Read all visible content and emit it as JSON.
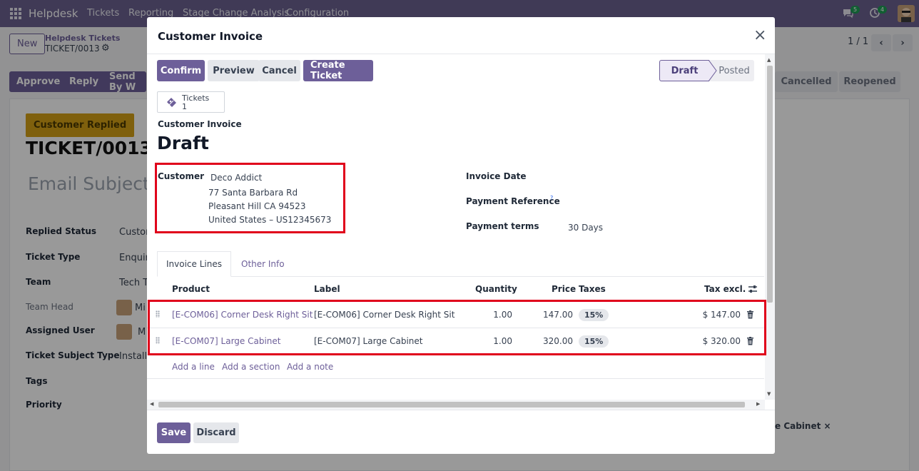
{
  "topbar": {
    "app_name": "Helpdesk",
    "menu": [
      "Tickets",
      "Reporting",
      "Stage Change Analysis",
      "Configuration"
    ],
    "chat_badge": "5",
    "activity_badge": "4"
  },
  "background": {
    "new_button": "New",
    "breadcrumb_parent": "Helpdesk Tickets",
    "breadcrumb_current": "TICKET/0013",
    "pager": "1 / 1",
    "actions": [
      "Approve",
      "Reply",
      "Send By W"
    ],
    "stages": [
      "Cancelled",
      "Reopened"
    ],
    "status_tag": "Customer Replied",
    "ticket_number": "TICKET/0013",
    "subject_placeholder": "Email Subject ...",
    "fields": [
      {
        "label": "Replied Status",
        "value": "Custom"
      },
      {
        "label": "Ticket Type",
        "value": "Enquir"
      },
      {
        "label": "Team",
        "value": "Tech Te"
      },
      {
        "label": "Team Head",
        "value": "Mi"
      },
      {
        "label": "Assigned User",
        "value": "M"
      },
      {
        "label": "Ticket Subject Type",
        "value": "Installa"
      },
      {
        "label": "Tags",
        "value": ""
      },
      {
        "label": "Priority",
        "value": ""
      }
    ],
    "tag_chip": "e Cabinet"
  },
  "modal": {
    "title": "Customer Invoice",
    "buttons": {
      "confirm": "Confirm",
      "preview": "Preview",
      "cancel": "Cancel",
      "create_ticket": "Create Ticket"
    },
    "status_steps": [
      "Draft",
      "Posted"
    ],
    "smart_button": {
      "label": "Tickets",
      "count": "1"
    },
    "doc_type": "Customer Invoice",
    "doc_state": "Draft",
    "customer": {
      "label": "Customer",
      "name": "Deco Addict",
      "street": "77 Santa Barbara Rd",
      "city": "Pleasant Hill CA 94523",
      "country": "United States – US12345673"
    },
    "invoice_date": {
      "label": "Invoice Date",
      "value": ""
    },
    "payment_reference": {
      "label": "Payment Reference",
      "help": "?",
      "value": ""
    },
    "payment_terms": {
      "label": "Payment terms",
      "value": "30 Days"
    },
    "tabs": [
      "Invoice Lines",
      "Other Info"
    ],
    "columns": {
      "product": "Product",
      "label": "Label",
      "quantity": "Quantity",
      "price": "Price",
      "taxes": "Taxes",
      "tax_excl": "Tax excl."
    },
    "lines": [
      {
        "product": "[E-COM06] Corner Desk Right Sit",
        "label": "[E-COM06] Corner Desk Right Sit",
        "quantity": "1.00",
        "price": "147.00",
        "tax": "15%",
        "subtotal": "$ 147.00"
      },
      {
        "product": "[E-COM07] Large Cabinet",
        "label": "[E-COM07] Large Cabinet",
        "quantity": "1.00",
        "price": "320.00",
        "tax": "15%",
        "subtotal": "$ 320.00"
      }
    ],
    "add_links": [
      "Add a line",
      "Add a section",
      "Add a note"
    ],
    "footer": {
      "save": "Save",
      "discard": "Discard"
    }
  }
}
